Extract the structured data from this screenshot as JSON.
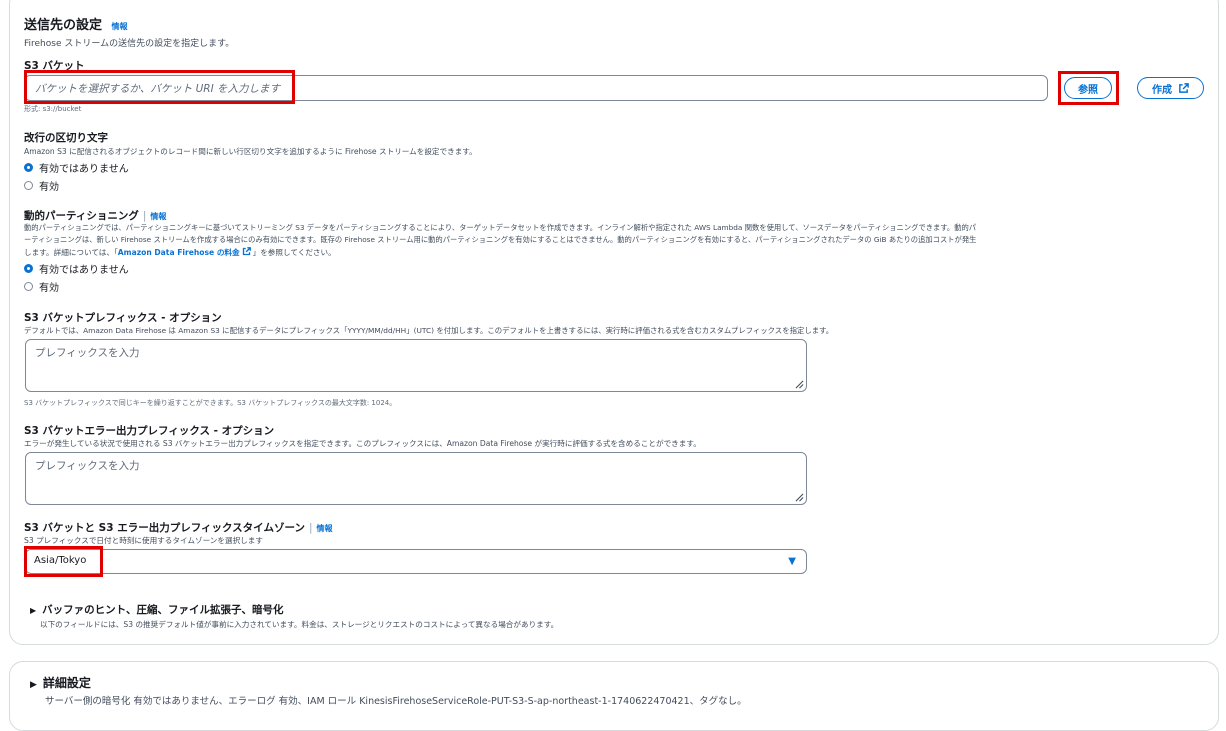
{
  "destination": {
    "title": "送信先の設定",
    "info_link": "情報",
    "description": "Firehose ストリームの送信先の設定を指定します。"
  },
  "s3_bucket": {
    "label": "S3 バケット",
    "placeholder": "バケットを選択するか、バケット URI を入力します",
    "browse_button": "参照",
    "create_button": "作成",
    "format_hint": "形式: s3://bucket"
  },
  "newline": {
    "label": "改行の区切り文字",
    "description": "Amazon S3 に配信されるオブジェクトのレコード間に新しい行区切り文字を追加するように Firehose ストリームを設定できます。",
    "options": [
      "有効ではありません",
      "有効"
    ],
    "selected": "有効ではありません"
  },
  "dynamic_partitioning": {
    "label": "動的パーティショニング",
    "info_link": "情報",
    "description_line1": "動的パーティショニングでは、パーティショニングキーに基づいてストリーミング S3 データをパーティショニングすることにより、ターゲットデータセットを作成できます。インライン解析や指定された AWS Lambda 関数を使用して、ソースデータをパーティショニングできます。動的パ",
    "description_line2": "ーティショニングは、新しい Firehose ストリームを作成する場合にのみ有効にできます。既存の Firehose ストリーム用に動的パーティショニングを有効にすることはできません。動的パーティショニングを有効にすると、パーティショニングされたデータの GiB あたりの追加コストが発生",
    "description_line3_pre": "します。詳細については、「",
    "pricing_link": "Amazon Data Firehose の料金",
    "description_line3_post": "」を参照してください。",
    "options": [
      "有効ではありません",
      "有効"
    ],
    "selected": "有効ではありません"
  },
  "bucket_prefix": {
    "label": "S3 バケットプレフィックス - オプション",
    "description": "デフォルトでは、Amazon Data Firehose は Amazon S3 に配信するデータにプレフィックス「YYYY/MM/dd/HH」(UTC) を付加します。このデフォルトを上書きするには、実行時に評価される式を含むカスタムプレフィックスを指定します。",
    "placeholder": "プレフィックスを入力",
    "hint": "S3 バケットプレフィックスで同じキーを繰り返すことができます。S3 バケットプレフィックスの最大文字数: 1024。"
  },
  "error_prefix": {
    "label": "S3 バケットエラー出力プレフィックス - オプション",
    "description": "エラーが発生している状況で使用される S3 バケットエラー出力プレフィックスを指定できます。このプレフィックスには、Amazon Data Firehose が実行時に評価する式を含めることができます。",
    "placeholder": "プレフィックスを入力"
  },
  "timezone": {
    "label": "S3 バケットと S3 エラー出力プレフィックスタイムゾーン",
    "info_link": "情報",
    "description": "S3 プレフィックスで日付と時刻に使用するタイムゾーンを選択します",
    "selected": "Asia/Tokyo"
  },
  "buffer": {
    "title": "バッファのヒント、圧縮、ファイル拡張子、暗号化",
    "description": "以下のフィールドには、S3 の推奨デフォルト値が事前に入力されています。料金は、ストレージとリクエストのコストによって異なる場合があります。"
  },
  "advanced": {
    "title": "詳細設定",
    "description": "サーバー側の暗号化 有効ではありません、エラーログ 有効、IAM ロール KinesisFirehoseServiceRole-PUT-S3-S-ap-northeast-1-1740622470421、タグなし。"
  },
  "colors": {
    "accent": "#0972d3",
    "highlight": "#e10000",
    "border": "#7d8998"
  }
}
